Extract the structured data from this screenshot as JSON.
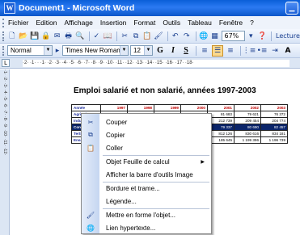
{
  "window": {
    "title": "Document1 - Microsoft Word",
    "app_icon": "W"
  },
  "menubar": {
    "items": [
      {
        "label": "Fichier"
      },
      {
        "label": "Edition"
      },
      {
        "label": "Affichage"
      },
      {
        "label": "Insertion"
      },
      {
        "label": "Format"
      },
      {
        "label": "Outils"
      },
      {
        "label": "Tableau"
      },
      {
        "label": "Fenêtre"
      },
      {
        "label": "?"
      }
    ]
  },
  "toolbar_standard": {
    "zoom": "67%",
    "reading": "Lecture"
  },
  "toolbar_format": {
    "style": "Normal",
    "font": "Times New Roman",
    "size": "12",
    "bold": "G",
    "italic": "I",
    "underline": "S"
  },
  "ruler": {
    "tab_selector": "L",
    "scale": "·2·  ·1·  ·    ·1·  ·2·  ·3·  ·4·  ·5·  ·6·  ·7·  ·8·  ·9·  ·10·  ·11·  ·12·  ·13·  ·14·  ·15·  ·16·  ·17·  ·18·",
    "vertical": "·1·  ·2·  ·3·  ·4·  ·5·  ·6·  ·7·  ·8·  ·9·  ·10·  ·11·  ·12·"
  },
  "document": {
    "title": "Emploi salarié et non salarié, années 1997-2003",
    "table": {
      "header": [
        "Année",
        "1997",
        "1998",
        "1999",
        "2000",
        "2001",
        "2002",
        "2003"
      ],
      "rows": [
        [
          "Agriculture",
          "88 102",
          "86 224",
          "86 344",
          "83 128",
          "81 683",
          "79 621",
          "76 372"
        ],
        [
          "Industrie",
          "",
          "",
          "",
          "",
          "212 739",
          "209 454",
          "204 774"
        ],
        [
          "Construction",
          "",
          "",
          "",
          "",
          "79 337",
          "80 690",
          "82 457"
        ],
        [
          "Tertiaire",
          "",
          "",
          "",
          "",
          "812 126",
          "830 616",
          "834 181"
        ],
        [
          "Ensemble",
          "",
          "",
          "",
          "",
          "185 645",
          "1 199 396",
          "1 196 739"
        ]
      ]
    }
  },
  "context_menu": {
    "items": [
      {
        "label": "Couper",
        "icon": "scissors-icon"
      },
      {
        "label": "Copier",
        "icon": "copy-icon"
      },
      {
        "label": "Coller",
        "icon": "paste-icon"
      },
      {
        "label": "Objet Feuille de calcul",
        "submenu": true
      },
      {
        "label": "Afficher la barre d'outils Image"
      },
      {
        "label": "Bordure et trame..."
      },
      {
        "label": "Légende..."
      },
      {
        "label": "Mettre en forme l'objet...",
        "icon": "format-object-icon"
      },
      {
        "label": "Lien hypertexte...",
        "icon": "hyperlink-icon"
      }
    ]
  }
}
